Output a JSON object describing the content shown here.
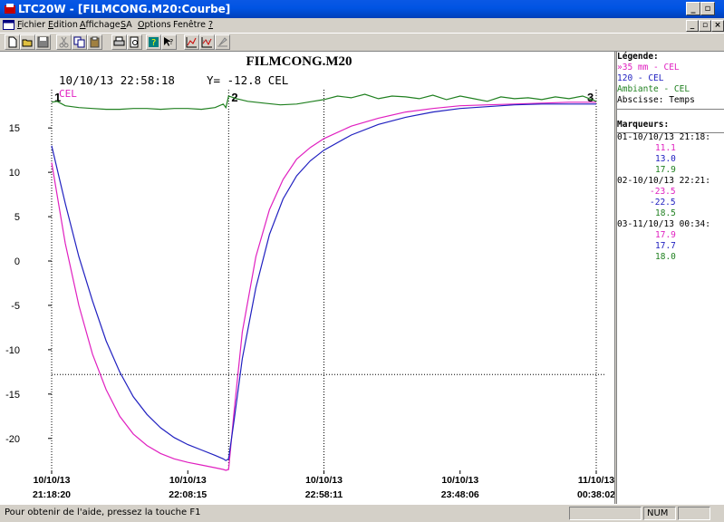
{
  "window": {
    "app_name": "LTC20W",
    "title": "LTC20W - [FILMCONG.M20:Courbe]",
    "colors": {
      "titlebar": "#0054e3",
      "pink": "#e020c0",
      "blue": "#2020c0",
      "green": "#208020"
    }
  },
  "title_controls": [
    "_",
    "▫",
    "×"
  ],
  "mdi_controls": [
    "_",
    "▫",
    "×"
  ],
  "menu": [
    {
      "label": "Fichier",
      "hot": "F",
      "rest": "ichier"
    },
    {
      "label": "Edition",
      "hot": "E",
      "rest": "dition"
    },
    {
      "label": "Affichage",
      "hot": "A",
      "rest": "ffichage"
    },
    {
      "label": "SA",
      "hot": "S",
      "rest": "A"
    },
    {
      "label": "Options",
      "hot": "O",
      "rest": "ptions"
    },
    {
      "label": "Fenêtre",
      "hot": "",
      "rest": "Fenêtre"
    },
    {
      "label": "?",
      "hot": "?",
      "rest": ""
    }
  ],
  "toolbar_icons": [
    "new-icon",
    "open-icon",
    "save-icon",
    "cut-icon",
    "copy-icon",
    "paste-icon",
    "print-icon",
    "print-preview-icon",
    "help-icon",
    "context-help-icon",
    "chart-grid-icon",
    "chart-line-icon",
    "chart-tool-icon"
  ],
  "chart_data": {
    "type": "line",
    "title": "FILMCONG.M20",
    "header_time": "10/10/13 22:58:18",
    "header_y": "Y= -12.8 CEL",
    "unit_label": "CEL",
    "ylim": [
      -23.6,
      18.8
    ],
    "yticks": [
      15,
      10,
      5,
      0,
      -5,
      -10,
      -15,
      -20
    ],
    "xlim_minutes": [
      0,
      200
    ],
    "xticks": [
      {
        "date": "10/10/13",
        "time": "21:18:20",
        "min": 0
      },
      {
        "date": "10/10/13",
        "time": "22:08:15",
        "min": 50
      },
      {
        "date": "10/10/13",
        "time": "22:58:11",
        "min": 100
      },
      {
        "date": "10/10/13",
        "time": "23:48:06",
        "min": 150
      },
      {
        "date": "11/10/13",
        "time": "00:38:02",
        "min": 200
      }
    ],
    "markers": [
      {
        "label": "1",
        "min": 0
      },
      {
        "label": "2",
        "min": 65
      },
      {
        "label": "3",
        "min": 200
      }
    ],
    "cursor": {
      "min": 100,
      "y": -12.8
    },
    "series": [
      {
        "name": "35 mm",
        "color": "#e020c0",
        "x": [
          0,
          5,
          10,
          15,
          20,
          25,
          30,
          35,
          40,
          45,
          50,
          55,
          60,
          63,
          64,
          65,
          67,
          70,
          75,
          80,
          85,
          90,
          95,
          100,
          110,
          120,
          130,
          140,
          150,
          160,
          170,
          180,
          190,
          200
        ],
        "y": [
          11.1,
          2.0,
          -5.0,
          -10.5,
          -14.5,
          -17.5,
          -19.5,
          -20.8,
          -21.7,
          -22.3,
          -22.7,
          -23.0,
          -23.3,
          -23.5,
          -23.6,
          -23.5,
          -17,
          -8,
          0.5,
          5.8,
          9.2,
          11.5,
          12.8,
          13.8,
          15.2,
          16.1,
          16.8,
          17.2,
          17.5,
          17.6,
          17.7,
          17.8,
          17.9,
          17.9
        ]
      },
      {
        "name": "120",
        "color": "#2020c0",
        "x": [
          0,
          5,
          10,
          15,
          20,
          25,
          30,
          35,
          40,
          45,
          50,
          55,
          60,
          63,
          64,
          65,
          67,
          70,
          75,
          80,
          85,
          90,
          95,
          100,
          110,
          120,
          130,
          140,
          150,
          160,
          170,
          180,
          190,
          200
        ],
        "y": [
          13.0,
          6.5,
          0.5,
          -4.5,
          -9.0,
          -12.5,
          -15.3,
          -17.3,
          -18.8,
          -19.9,
          -20.7,
          -21.3,
          -21.9,
          -22.3,
          -22.5,
          -22.3,
          -18,
          -11,
          -3,
          3.0,
          7.0,
          9.6,
          11.3,
          12.5,
          14.2,
          15.4,
          16.2,
          16.8,
          17.2,
          17.4,
          17.6,
          17.7,
          17.7,
          17.7
        ]
      },
      {
        "name": "Ambiante",
        "color": "#208020",
        "x": [
          0,
          2,
          5,
          10,
          15,
          20,
          25,
          30,
          35,
          40,
          45,
          50,
          55,
          60,
          63,
          64,
          65,
          68,
          72,
          78,
          84,
          90,
          96,
          100,
          105,
          110,
          115,
          120,
          125,
          130,
          135,
          140,
          145,
          150,
          155,
          160,
          165,
          170,
          175,
          180,
          185,
          190,
          195,
          200
        ],
        "y": [
          17.9,
          18.0,
          17.5,
          17.3,
          17.2,
          17.1,
          17.1,
          17.2,
          17.2,
          17.1,
          17.2,
          17.2,
          17.1,
          17.3,
          17.7,
          17.3,
          18.6,
          18.3,
          18.0,
          17.8,
          17.6,
          17.7,
          18.0,
          18.2,
          18.6,
          18.4,
          18.8,
          18.3,
          18.6,
          18.5,
          18.3,
          18.7,
          18.2,
          18.6,
          18.3,
          18.0,
          18.5,
          18.3,
          18.4,
          18.2,
          18.5,
          18.3,
          18.6,
          18.0
        ]
      }
    ]
  },
  "legend": {
    "title": "Légende:",
    "entries": [
      {
        "text": "»35 mm    - CEL",
        "color": "#e020c0"
      },
      {
        "text": " 120      - CEL",
        "color": "#2020c0"
      },
      {
        "text": " Ambiante - CEL",
        "color": "#208020"
      }
    ],
    "abscissa": " Abscisse: Temps",
    "markers_title": "Marqueurs:",
    "marker_groups": [
      {
        "header": " 01-10/10/13 21:18:",
        "values": [
          {
            "v": "11.1",
            "c": "#e020c0"
          },
          {
            "v": "13.0",
            "c": "#2020c0"
          },
          {
            "v": "17.9",
            "c": "#208020"
          }
        ]
      },
      {
        "header": " 02-10/10/13 22:21:",
        "values": [
          {
            "v": "-23.5",
            "c": "#e020c0"
          },
          {
            "v": "-22.5",
            "c": "#2020c0"
          },
          {
            "v": "18.5",
            "c": "#208020"
          }
        ]
      },
      {
        "header": " 03-11/10/13 00:34:",
        "values": [
          {
            "v": "17.9",
            "c": "#e020c0"
          },
          {
            "v": "17.7",
            "c": "#2020c0"
          },
          {
            "v": "18.0",
            "c": "#208020"
          }
        ]
      }
    ]
  },
  "status": {
    "help": "Pour obtenir de l'aide, pressez la touche F1",
    "num": "NUM"
  }
}
